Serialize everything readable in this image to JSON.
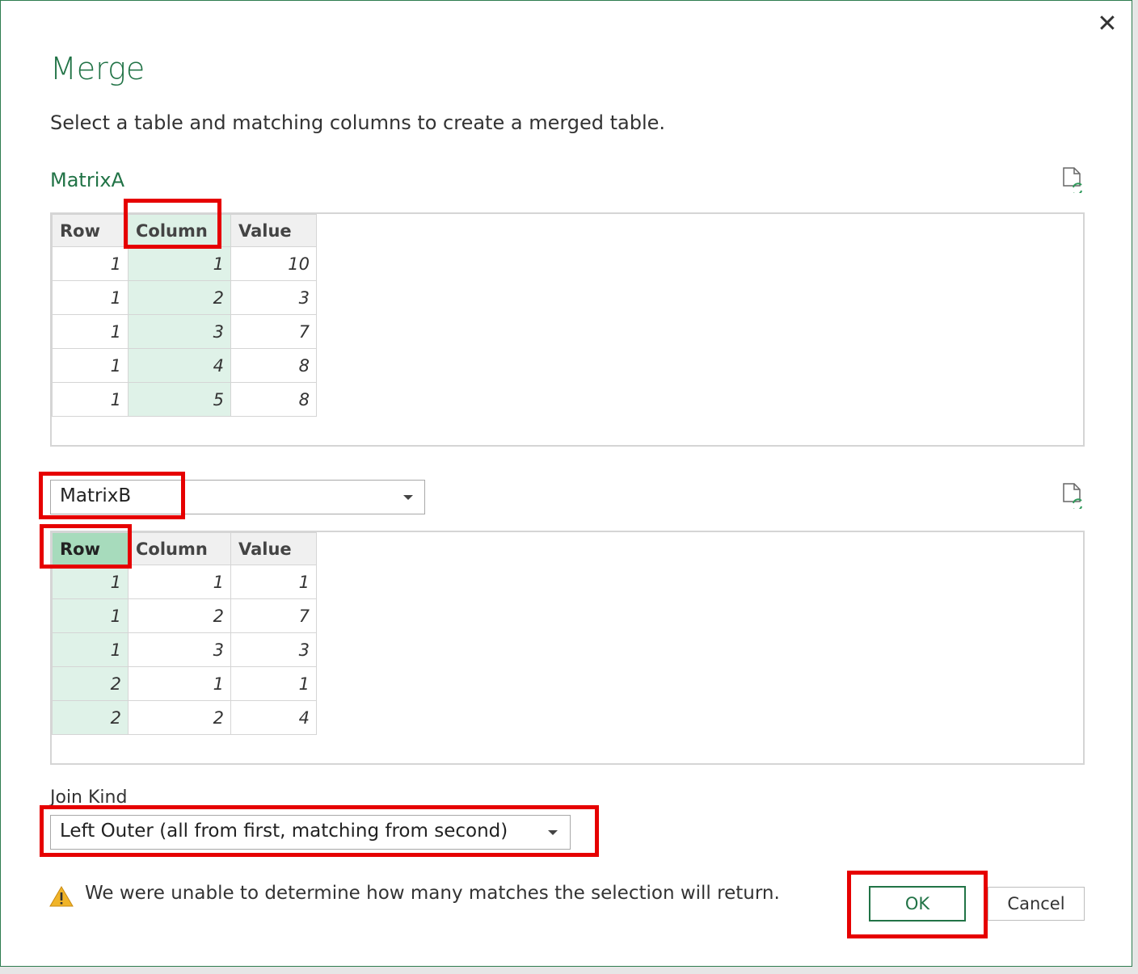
{
  "dialog": {
    "title": "Merge",
    "subtitle": "Select a table and matching columns to create a merged table.",
    "close_glyph": "✕"
  },
  "first_table": {
    "name": "MatrixA",
    "selected_column": "Column",
    "columns": [
      "Row",
      "Column",
      "Value"
    ],
    "rows": [
      [
        "1",
        "1",
        "10"
      ],
      [
        "1",
        "2",
        "3"
      ],
      [
        "1",
        "3",
        "7"
      ],
      [
        "1",
        "4",
        "8"
      ],
      [
        "1",
        "5",
        "8"
      ]
    ]
  },
  "second_table": {
    "selected_table": "MatrixB",
    "selected_column": "Row",
    "columns": [
      "Row",
      "Column",
      "Value"
    ],
    "rows": [
      [
        "1",
        "1",
        "1"
      ],
      [
        "1",
        "2",
        "7"
      ],
      [
        "1",
        "3",
        "3"
      ],
      [
        "2",
        "1",
        "1"
      ],
      [
        "2",
        "2",
        "4"
      ]
    ]
  },
  "join": {
    "label": "Join Kind",
    "selected": "Left Outer (all from first, matching from second)"
  },
  "warning": {
    "text": "We were unable to determine how many matches the selection will return."
  },
  "buttons": {
    "ok": "OK",
    "cancel": "Cancel"
  },
  "icons": {
    "refresh": "refresh-document-icon",
    "warning": "warning-icon",
    "dropdown": "chevron-down-icon"
  },
  "colors": {
    "accent": "#217346",
    "selected_column_fill": "#dff2e8",
    "selected_header_fill": "#a7dbbc",
    "highlight": "#e60000",
    "warning": "#f0b429"
  }
}
